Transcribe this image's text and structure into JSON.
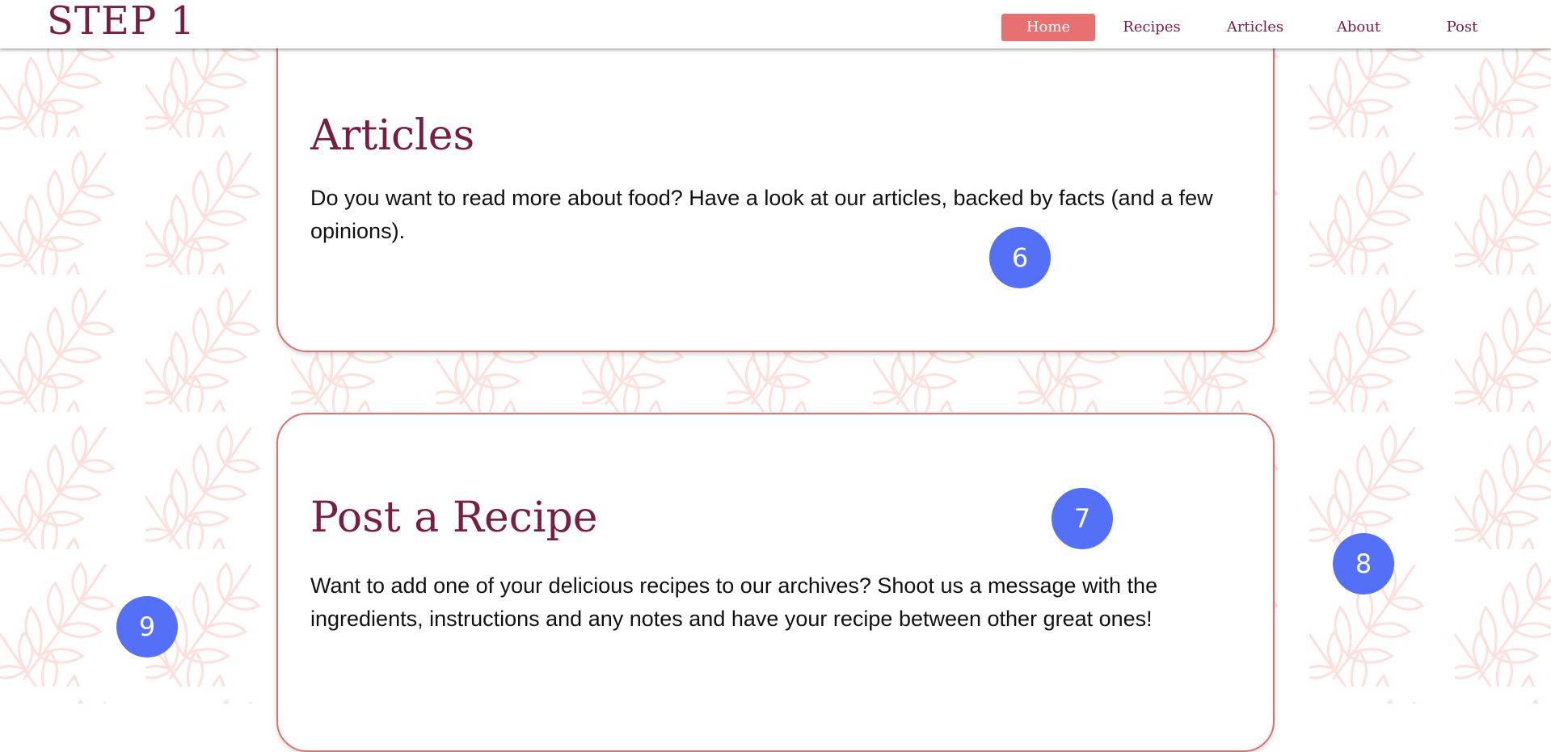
{
  "header": {
    "logo": "STEP 1",
    "nav": [
      {
        "label": "Home",
        "active": true
      },
      {
        "label": "Recipes",
        "active": false
      },
      {
        "label": "Articles",
        "active": false
      },
      {
        "label": "About",
        "active": false
      },
      {
        "label": "Post",
        "active": false
      }
    ]
  },
  "cards": [
    {
      "title": "Articles",
      "text": "Do you want to read more about food? Have a look at our articles, backed by facts (and a few opinions)."
    },
    {
      "title": "Post a Recipe",
      "text": "Want to add one of your delicious recipes to our archives? Shoot us a message with the ingredients, instructions and any notes and have your recipe between other great ones!"
    }
  ],
  "markers": [
    "6",
    "7",
    "8",
    "9"
  ],
  "colors": {
    "brand": "#7a1d43",
    "accent": "#e97070",
    "card_border": "#e26f6f",
    "marker": "#5470f6",
    "pattern": "#fde4e1"
  },
  "icons": [
    "leaf-pattern"
  ]
}
